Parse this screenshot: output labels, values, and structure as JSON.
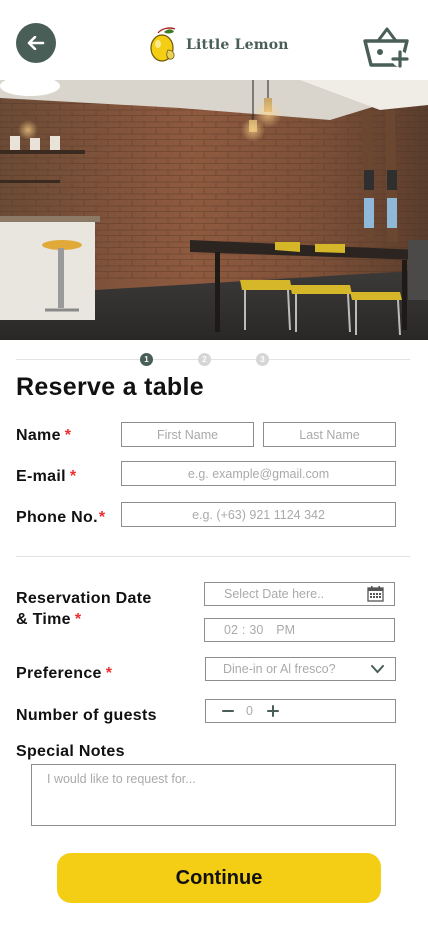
{
  "brand": {
    "name": "Little Lemon"
  },
  "icons": {
    "back": "arrow-left-icon",
    "basket": "basket-add-icon",
    "calendar": "calendar-icon",
    "dropdown": "chevron-down-icon",
    "minus": "minus-icon",
    "plus": "plus-icon"
  },
  "colors": {
    "primary": "#495E57",
    "accent": "#F4CE14",
    "required": "#EE2D2D"
  },
  "stepper": {
    "steps": [
      "1",
      "2",
      "3"
    ],
    "current": 1
  },
  "form": {
    "title": "Reserve a table",
    "name": {
      "label": "Name",
      "required": "*",
      "first_placeholder": "First Name",
      "last_placeholder": "Last Name"
    },
    "email": {
      "label": "E-mail",
      "required": "*",
      "placeholder": "e.g. example@gmail.com"
    },
    "phone": {
      "label": "Phone No.",
      "required": "*",
      "placeholder": "e.g. (+63) 921 1124 342"
    },
    "reservation": {
      "label_line1": "Reservation Date",
      "label_line2": "& Time",
      "required": "*",
      "date_placeholder": "Select Date here..",
      "time_hour": "02",
      "time_sep": ":",
      "time_minute": "30",
      "time_period": "PM"
    },
    "preference": {
      "label": "Preference",
      "required": "*",
      "placeholder": "Dine-in or Al fresco?"
    },
    "guests": {
      "label": "Number of guests",
      "value": "0"
    },
    "notes": {
      "label": "Special Notes",
      "placeholder": "I would like to request for..."
    },
    "continue_label": "Continue"
  }
}
